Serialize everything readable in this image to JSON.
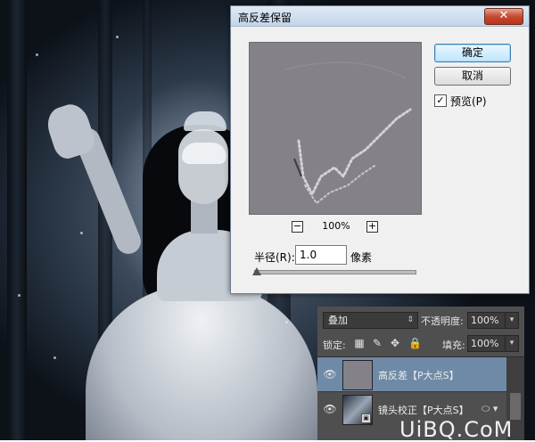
{
  "dialog": {
    "title": "高反差保留",
    "close_symbol": "✕",
    "ok_label": "确定",
    "cancel_label": "取消",
    "preview_label": "预览(P)",
    "preview_checked": true,
    "check_mark": "✓",
    "zoom_minus": "−",
    "zoom_plus": "+",
    "zoom_value": "100%",
    "radius_label": "半径(R):",
    "radius_value": "1.0",
    "unit_label": "像素"
  },
  "layers_panel": {
    "blend_mode": "叠加",
    "opacity_label": "不透明度:",
    "opacity_value": "100%",
    "lock_label": "锁定:",
    "lock_icons": [
      "transparency-lock-icon",
      "brush-icon",
      "move-icon",
      "lock-icon"
    ],
    "fill_label": "填充:",
    "fill_value": "100%",
    "dropdown_arrow": "▾",
    "layers": [
      {
        "name": "高反差【P大点S】",
        "selected": true,
        "eye": "👁"
      },
      {
        "name": "镜头校正【P大点S】",
        "selected": false,
        "eye": "👁",
        "fx": "⬭ ▾"
      }
    ]
  },
  "watermark": "UiBQ.CoM",
  "colors": {
    "accent": "#6f8aa6",
    "preview_gray": "#858189",
    "panel_bg": "#4f4f4f"
  }
}
